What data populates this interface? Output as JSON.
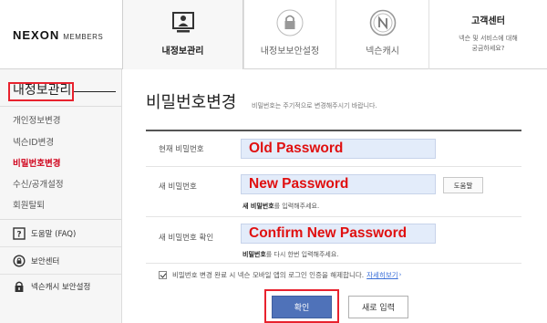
{
  "header": {
    "logo_main": "NEXON",
    "logo_sub": "MEMBERS",
    "nav": [
      {
        "label": "내정보관리",
        "icon": "monitor-user-icon",
        "active": true
      },
      {
        "label": "내정보보안설정",
        "icon": "padlock-icon",
        "active": false
      },
      {
        "label": "넥슨캐시",
        "icon": "nexon-cash-coin-icon",
        "active": false
      }
    ],
    "customer_center": {
      "title": "고객센터",
      "desc_line1": "넥슨 및 서비스에 대해",
      "desc_line2": "궁금하세요?"
    }
  },
  "sidebar": {
    "title": "내정보관리",
    "items": [
      {
        "label": "개인정보변경",
        "active": false
      },
      {
        "label": "넥슨ID변경",
        "active": false
      },
      {
        "label": "비밀번호변경",
        "active": true
      },
      {
        "label": "수신/공개설정",
        "active": false
      },
      {
        "label": "회원탈퇴",
        "active": false
      }
    ],
    "quick_links": [
      {
        "label": "도움말 (FAQ)",
        "icon": "help-question-icon"
      },
      {
        "label": "보안센터",
        "icon": "security-center-icon"
      },
      {
        "label": "넥슨캐시 보안설정",
        "icon": "lock-shield-icon"
      }
    ]
  },
  "main": {
    "title": "비밀번호변경",
    "subtitle": "비밀번호는 주기적으로 변경해주시기 바랍니다.",
    "fields": [
      {
        "label": "현재 비밀번호",
        "value": "Old Password"
      },
      {
        "label": "새 비밀번호",
        "value": "New Password",
        "hint_bold": "새 비밀번호",
        "hint_rest": "를 입력해주세요."
      },
      {
        "label": "새 비밀번호 확인",
        "value": "Confirm New Password",
        "hint_bold": "비밀번호",
        "hint_rest": "를 다시 한번 입력해주세요."
      }
    ],
    "help_button": "도움말",
    "checkbox": {
      "checked": true,
      "text": "비밀번호 변경 완료 시 넥슨 모바일 앱의 로그인 인증을 해제합니다.",
      "link": "자세히보기",
      "link_arrow": "›"
    },
    "confirm_button": "확인",
    "reset_button": "새로 입력"
  },
  "colors": {
    "accent_blue": "#4f72b9",
    "highlight_red": "#e8222e",
    "active_menu_red": "#d0021b",
    "input_bg": "#e3ecfa",
    "overlay_text_red": "#e01010"
  }
}
